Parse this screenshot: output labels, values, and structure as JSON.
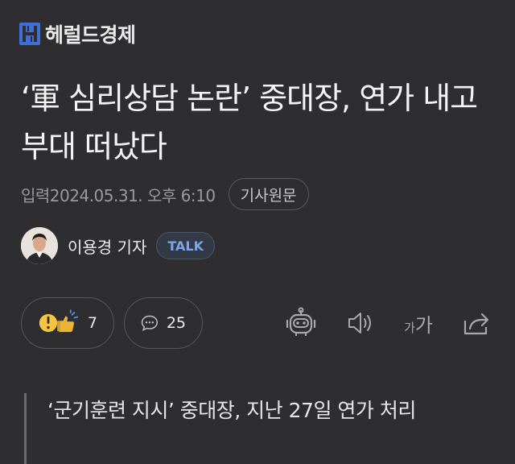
{
  "brand": {
    "name": "헤럴드경제",
    "accent": "#3d6fd6"
  },
  "article": {
    "headline": "‘軍 심리상담 논란’ 중대장, 연가 내고 부대 떠났다",
    "timestamp": "입력2024.05.31. 오후 6:10",
    "source_button": "기사원문",
    "reporter": {
      "name": "이용경 기자",
      "talk_label": "TALK"
    }
  },
  "actions": {
    "reaction_count": "7",
    "comment_count": "25",
    "icons": [
      "reaction-icon",
      "comment-icon",
      "robot-summary-icon",
      "audio-icon",
      "font-size-icon",
      "share-icon"
    ],
    "font_size_small": "가",
    "font_size_big": "가"
  },
  "subheading": "‘군기훈련 지시’ 중대장, 지난 27일 연가 처리"
}
